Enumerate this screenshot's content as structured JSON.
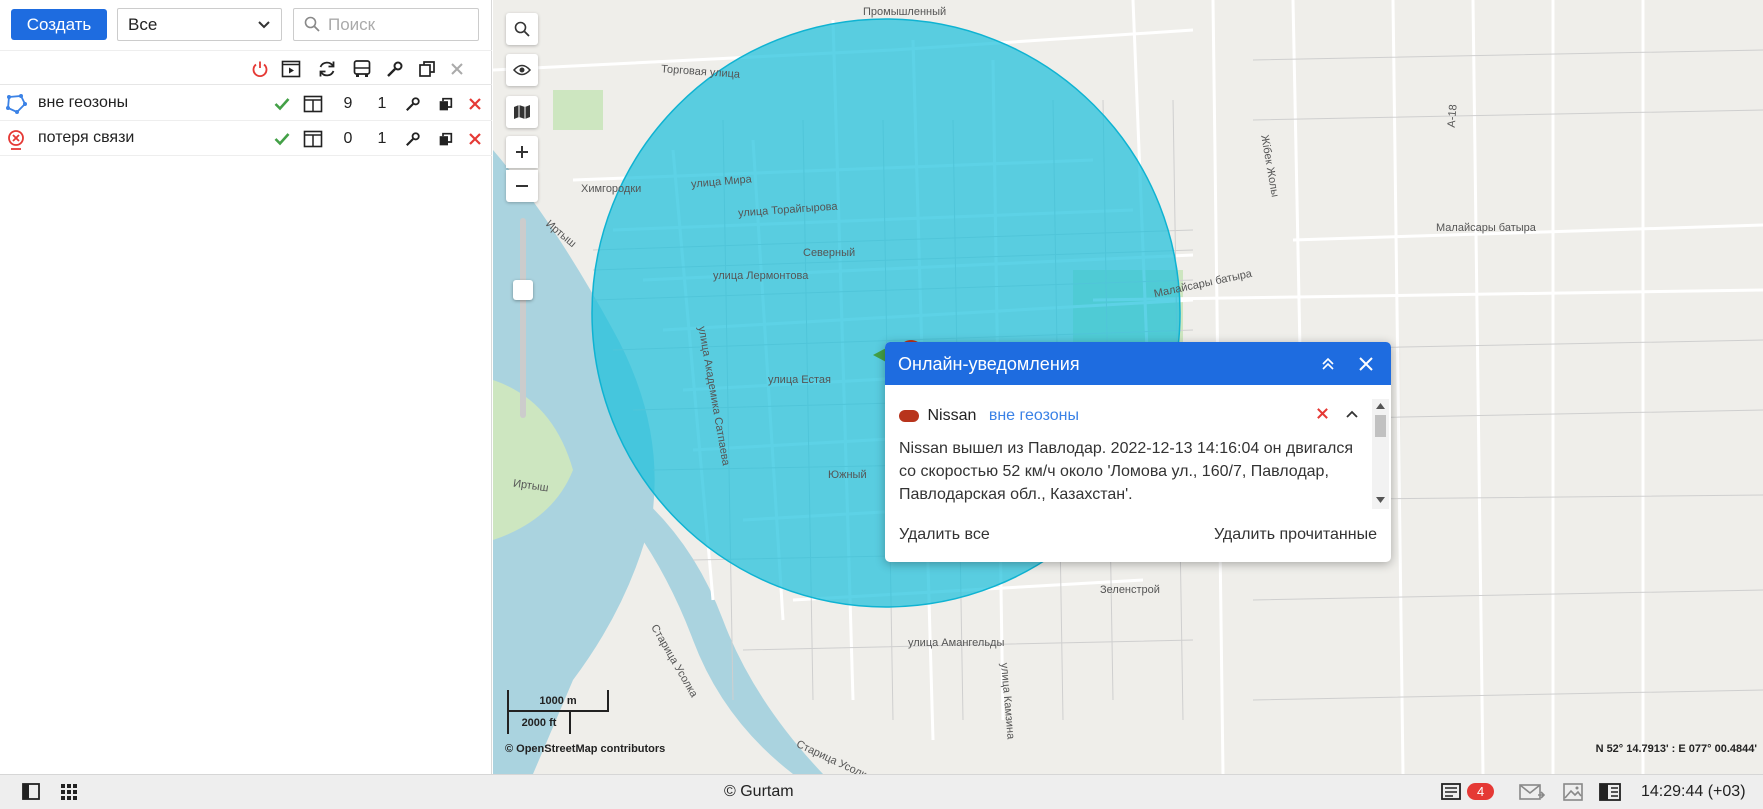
{
  "toolbar": {
    "create_label": "Создать",
    "filter_value": "Все",
    "search_placeholder": "Поиск"
  },
  "notifications_list": [
    {
      "name": "вне геозоны",
      "col1": "9",
      "col2": "1",
      "icon": "geofence-icon"
    },
    {
      "name": "потеря связи",
      "col1": "0",
      "col2": "1",
      "icon": "connection-loss-icon"
    }
  ],
  "map": {
    "scale_metric": "1000 m",
    "scale_imperial": "2000 ft",
    "attribution": "© OpenStreetMap contributors",
    "coordinates": "N 52° 14.7913' : E 077° 00.4844'",
    "circle_color": "#1ec0dc",
    "labels": {
      "l1": "Промышленный",
      "l2": "Торговая улица",
      "l3": "Химгородки",
      "l4": "улица Мира",
      "l5": "улица Торайгырова",
      "l6": "Северный",
      "l7": "улица Лермонтова",
      "l8": "улица Академика Сатпаева",
      "l9": "улица Естая",
      "l10": "Южный",
      "l11": "Иртыш",
      "l12": "Иртыш",
      "l13": "Малайсары батыра",
      "l14": "Малайсары батыра",
      "l15": "Жібек Жолы",
      "l16": "Зеленстрой",
      "l17": "улица Амангельды",
      "l18": "улица Камзина",
      "l19": "Старица Усолка",
      "l20": "Старица Усолка",
      "l21": "A-18"
    }
  },
  "popup": {
    "title": "Онлайн-уведомления",
    "unit_name": "Nissan",
    "event_name": "вне геозоны",
    "message": "Nissan вышел из Павлодар. 2022-12-13 14:16:04 он двигался со скоростью 52 км/ч около 'Ломова ул., 160/7, Павлодар, Павлодарская обл., Казахстан'.",
    "delete_all": "Удалить все",
    "delete_read": "Удалить прочитанные"
  },
  "bottom": {
    "copyright": "© Gurtam",
    "notif_count": "4",
    "time": "14:29:44 (+03)"
  },
  "colors": {
    "accent": "#1e6ce0",
    "danger": "#e53935",
    "ok": "#43a047"
  }
}
